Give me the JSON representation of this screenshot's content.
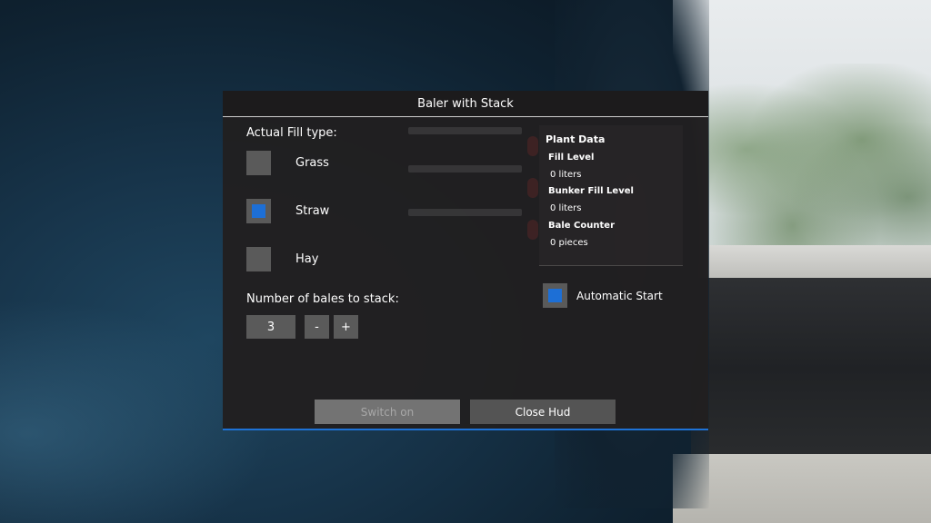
{
  "dialog": {
    "title": "Baler with Stack"
  },
  "fill_type": {
    "label": "Actual Fill type:",
    "options": [
      {
        "label": "Grass",
        "checked": false
      },
      {
        "label": "Straw",
        "checked": true
      },
      {
        "label": "Hay",
        "checked": false
      }
    ]
  },
  "bales": {
    "label": "Number of bales to stack:",
    "value": "3",
    "minus_label": "-",
    "plus_label": "+"
  },
  "plant_data": {
    "title": "Plant Data",
    "fill_level_label": "Fill Level",
    "fill_level_value": "0 liters",
    "bunker_fill_level_label": "Bunker Fill Level",
    "bunker_fill_level_value": "0 liters",
    "bale_counter_label": "Bale Counter",
    "bale_counter_value": "0 pieces"
  },
  "automatic_start": {
    "label": "Automatic Start",
    "checked": true
  },
  "buttons": {
    "switch_on": "Switch on",
    "close_hud": "Close Hud"
  },
  "colors": {
    "accent": "#1d6fd6",
    "panel_bg": "#211f20",
    "control_bg": "#5a5a5a",
    "disabled_bg": "#737373"
  },
  "icons": {
    "checked_mark": "checkbox-checked-icon",
    "unchecked": "checkbox-empty-icon"
  }
}
